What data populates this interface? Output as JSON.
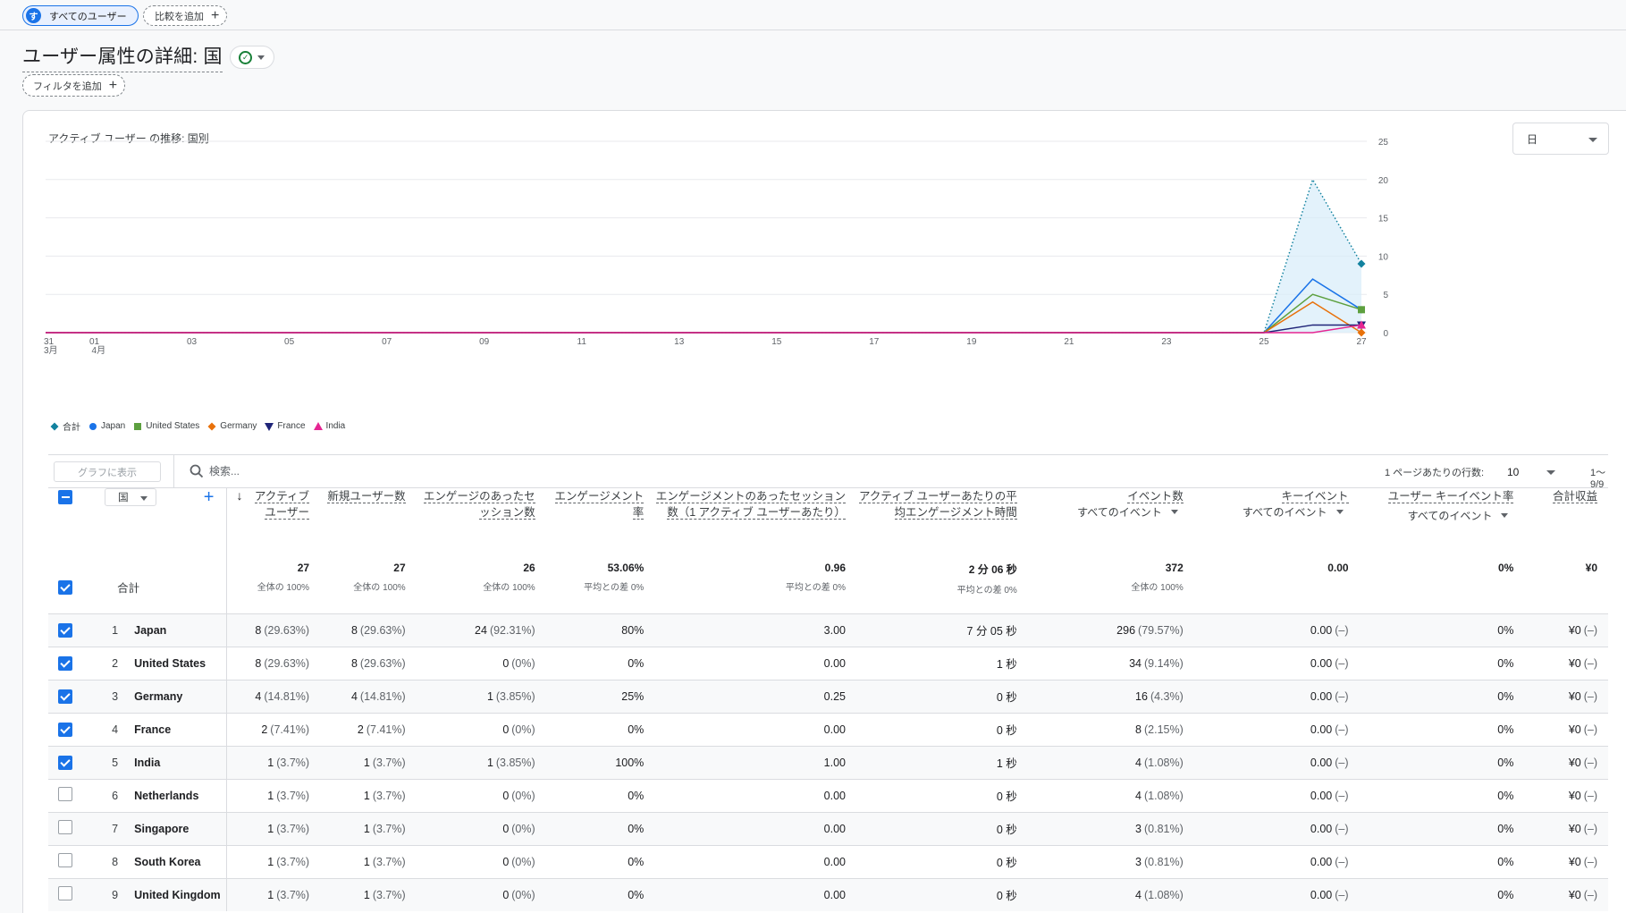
{
  "comparison": {
    "all_users_avatar": "す",
    "all_users_label": "すべてのユーザー",
    "add_comparison_label": "比較を追加"
  },
  "header": {
    "title": "ユーザー属性の詳細: 国",
    "add_filter_label": "フィルタを追加"
  },
  "chart_card": {
    "title": "アクティブ ユーザー の推移: 国別",
    "granularity": "日"
  },
  "chart_data": {
    "type": "line",
    "title": "アクティブ ユーザー の推移: 国別",
    "x_ticks": [
      "31",
      "01",
      "03",
      "05",
      "07",
      "09",
      "11",
      "13",
      "15",
      "17",
      "19",
      "21",
      "23",
      "25",
      "27"
    ],
    "x_tick_months": {
      "31": "3月",
      "01": "4月"
    },
    "x_dates": [
      "03-31",
      "04-01",
      "04-02",
      "04-03",
      "04-04",
      "04-05",
      "04-06",
      "04-07",
      "04-08",
      "04-09",
      "04-10",
      "04-11",
      "04-12",
      "04-13",
      "04-14",
      "04-15",
      "04-16",
      "04-17",
      "04-18",
      "04-19",
      "04-20",
      "04-21",
      "04-22",
      "04-23",
      "04-24",
      "04-25",
      "04-26",
      "04-27"
    ],
    "y_ticks": [
      "0",
      "5",
      "10",
      "15",
      "20",
      "25"
    ],
    "ylim": [
      0,
      25
    ],
    "y_axis_side": "right",
    "grid": true,
    "legend_position": "bottom-left",
    "series": [
      {
        "name": "合計",
        "color": "#12829f",
        "marker": "diamond",
        "style": "dotted-area",
        "values": [
          0,
          0,
          0,
          0,
          0,
          0,
          0,
          0,
          0,
          0,
          0,
          0,
          0,
          0,
          0,
          0,
          0,
          0,
          0,
          0,
          0,
          0,
          0,
          0,
          0,
          0,
          20,
          9
        ]
      },
      {
        "name": "Japan",
        "color": "#1a73e8",
        "marker": "circle",
        "style": "line",
        "values": [
          0,
          0,
          0,
          0,
          0,
          0,
          0,
          0,
          0,
          0,
          0,
          0,
          0,
          0,
          0,
          0,
          0,
          0,
          0,
          0,
          0,
          0,
          0,
          0,
          0,
          0,
          7,
          3
        ]
      },
      {
        "name": "United States",
        "color": "#5da03f",
        "marker": "square",
        "style": "line",
        "values": [
          0,
          0,
          0,
          0,
          0,
          0,
          0,
          0,
          0,
          0,
          0,
          0,
          0,
          0,
          0,
          0,
          0,
          0,
          0,
          0,
          0,
          0,
          0,
          0,
          0,
          0,
          5,
          3
        ]
      },
      {
        "name": "Germany",
        "color": "#e8710a",
        "marker": "diamond",
        "style": "line",
        "values": [
          0,
          0,
          0,
          0,
          0,
          0,
          0,
          0,
          0,
          0,
          0,
          0,
          0,
          0,
          0,
          0,
          0,
          0,
          0,
          0,
          0,
          0,
          0,
          0,
          0,
          0,
          4,
          0
        ]
      },
      {
        "name": "France",
        "color": "#1f2478",
        "marker": "triangle-down",
        "style": "line",
        "values": [
          0,
          0,
          0,
          0,
          0,
          0,
          0,
          0,
          0,
          0,
          0,
          0,
          0,
          0,
          0,
          0,
          0,
          0,
          0,
          0,
          0,
          0,
          0,
          0,
          0,
          0,
          1,
          1
        ]
      },
      {
        "name": "India",
        "color": "#e52592",
        "marker": "triangle-up",
        "style": "line",
        "values": [
          0,
          0,
          0,
          0,
          0,
          0,
          0,
          0,
          0,
          0,
          0,
          0,
          0,
          0,
          0,
          0,
          0,
          0,
          0,
          0,
          0,
          0,
          0,
          0,
          0,
          0,
          0,
          1
        ]
      }
    ]
  },
  "table_toolbar": {
    "graph_button": "グラフに表示",
    "search_placeholder": "検索...",
    "rows_per_page_label": "1 ページあたりの行数:",
    "rows_per_page": "10",
    "pager": "1～9/9"
  },
  "table": {
    "dimension": "国",
    "columns": [
      {
        "label": "アクティブ ユーザー",
        "sub": ""
      },
      {
        "label": "新規ユーザー数",
        "sub": ""
      },
      {
        "label": "エンゲージのあったセッション数",
        "sub": ""
      },
      {
        "label": "エンゲージメント率",
        "sub": ""
      },
      {
        "label": "エンゲージメントのあったセッション数（1 アクティブ ユーザーあたり）",
        "sub": ""
      },
      {
        "label": "アクティブ ユーザーあたりの平均エンゲージメント時間",
        "sub": ""
      },
      {
        "label": "イベント数",
        "sub": "すべてのイベント"
      },
      {
        "label": "キーイベント",
        "sub": "すべてのイベント"
      },
      {
        "label": "ユーザー キーイベント率",
        "sub": "すべてのイベント"
      },
      {
        "label": "合計収益",
        "sub": ""
      }
    ],
    "total_label": "合計",
    "totals": [
      {
        "main": "27",
        "sub": "全体の 100%"
      },
      {
        "main": "27",
        "sub": "全体の 100%"
      },
      {
        "main": "26",
        "sub": "全体の 100%"
      },
      {
        "main": "53.06%",
        "sub": "平均との差 0%"
      },
      {
        "main": "0.96",
        "sub": "平均との差 0%"
      },
      {
        "main": "2 分 06 秒",
        "sub": "平均との差 0%"
      },
      {
        "main": "372",
        "sub": "全体の 100%"
      },
      {
        "main": "0.00",
        "sub": ""
      },
      {
        "main": "0%",
        "sub": ""
      },
      {
        "main": "¥0",
        "sub": ""
      }
    ],
    "rows": [
      {
        "rank": "1",
        "country": "Japan",
        "checked": true,
        "cells": [
          [
            "8",
            "(29.63%)"
          ],
          [
            "8",
            "(29.63%)"
          ],
          [
            "24",
            "(92.31%)"
          ],
          [
            "80%",
            ""
          ],
          [
            "3.00",
            ""
          ],
          [
            "7 分 05 秒",
            ""
          ],
          [
            "296",
            "(79.57%)"
          ],
          [
            "0.00",
            "(–)"
          ],
          [
            "0%",
            ""
          ],
          [
            "¥0",
            "(–)"
          ]
        ]
      },
      {
        "rank": "2",
        "country": "United States",
        "checked": true,
        "cells": [
          [
            "8",
            "(29.63%)"
          ],
          [
            "8",
            "(29.63%)"
          ],
          [
            "0",
            "(0%)"
          ],
          [
            "0%",
            ""
          ],
          [
            "0.00",
            ""
          ],
          [
            "1 秒",
            ""
          ],
          [
            "34",
            "(9.14%)"
          ],
          [
            "0.00",
            "(–)"
          ],
          [
            "0%",
            ""
          ],
          [
            "¥0",
            "(–)"
          ]
        ]
      },
      {
        "rank": "3",
        "country": "Germany",
        "checked": true,
        "cells": [
          [
            "4",
            "(14.81%)"
          ],
          [
            "4",
            "(14.81%)"
          ],
          [
            "1",
            "(3.85%)"
          ],
          [
            "25%",
            ""
          ],
          [
            "0.25",
            ""
          ],
          [
            "0 秒",
            ""
          ],
          [
            "16",
            "(4.3%)"
          ],
          [
            "0.00",
            "(–)"
          ],
          [
            "0%",
            ""
          ],
          [
            "¥0",
            "(–)"
          ]
        ]
      },
      {
        "rank": "4",
        "country": "France",
        "checked": true,
        "cells": [
          [
            "2",
            "(7.41%)"
          ],
          [
            "2",
            "(7.41%)"
          ],
          [
            "0",
            "(0%)"
          ],
          [
            "0%",
            ""
          ],
          [
            "0.00",
            ""
          ],
          [
            "0 秒",
            ""
          ],
          [
            "8",
            "(2.15%)"
          ],
          [
            "0.00",
            "(–)"
          ],
          [
            "0%",
            ""
          ],
          [
            "¥0",
            "(–)"
          ]
        ]
      },
      {
        "rank": "5",
        "country": "India",
        "checked": true,
        "cells": [
          [
            "1",
            "(3.7%)"
          ],
          [
            "1",
            "(3.7%)"
          ],
          [
            "1",
            "(3.85%)"
          ],
          [
            "100%",
            ""
          ],
          [
            "1.00",
            ""
          ],
          [
            "1 秒",
            ""
          ],
          [
            "4",
            "(1.08%)"
          ],
          [
            "0.00",
            "(–)"
          ],
          [
            "0%",
            ""
          ],
          [
            "¥0",
            "(–)"
          ]
        ]
      },
      {
        "rank": "6",
        "country": "Netherlands",
        "checked": false,
        "cells": [
          [
            "1",
            "(3.7%)"
          ],
          [
            "1",
            "(3.7%)"
          ],
          [
            "0",
            "(0%)"
          ],
          [
            "0%",
            ""
          ],
          [
            "0.00",
            ""
          ],
          [
            "0 秒",
            ""
          ],
          [
            "4",
            "(1.08%)"
          ],
          [
            "0.00",
            "(–)"
          ],
          [
            "0%",
            ""
          ],
          [
            "¥0",
            "(–)"
          ]
        ]
      },
      {
        "rank": "7",
        "country": "Singapore",
        "checked": false,
        "cells": [
          [
            "1",
            "(3.7%)"
          ],
          [
            "1",
            "(3.7%)"
          ],
          [
            "0",
            "(0%)"
          ],
          [
            "0%",
            ""
          ],
          [
            "0.00",
            ""
          ],
          [
            "0 秒",
            ""
          ],
          [
            "3",
            "(0.81%)"
          ],
          [
            "0.00",
            "(–)"
          ],
          [
            "0%",
            ""
          ],
          [
            "¥0",
            "(–)"
          ]
        ]
      },
      {
        "rank": "8",
        "country": "South Korea",
        "checked": false,
        "cells": [
          [
            "1",
            "(3.7%)"
          ],
          [
            "1",
            "(3.7%)"
          ],
          [
            "0",
            "(0%)"
          ],
          [
            "0%",
            ""
          ],
          [
            "0.00",
            ""
          ],
          [
            "0 秒",
            ""
          ],
          [
            "3",
            "(0.81%)"
          ],
          [
            "0.00",
            "(–)"
          ],
          [
            "0%",
            ""
          ],
          [
            "¥0",
            "(–)"
          ]
        ]
      },
      {
        "rank": "9",
        "country": "United Kingdom",
        "checked": false,
        "cells": [
          [
            "1",
            "(3.7%)"
          ],
          [
            "1",
            "(3.7%)"
          ],
          [
            "0",
            "(0%)"
          ],
          [
            "0%",
            ""
          ],
          [
            "0.00",
            ""
          ],
          [
            "0 秒",
            ""
          ],
          [
            "4",
            "(1.08%)"
          ],
          [
            "0.00",
            "(–)"
          ],
          [
            "0%",
            ""
          ],
          [
            "¥0",
            "(–)"
          ]
        ]
      }
    ]
  }
}
